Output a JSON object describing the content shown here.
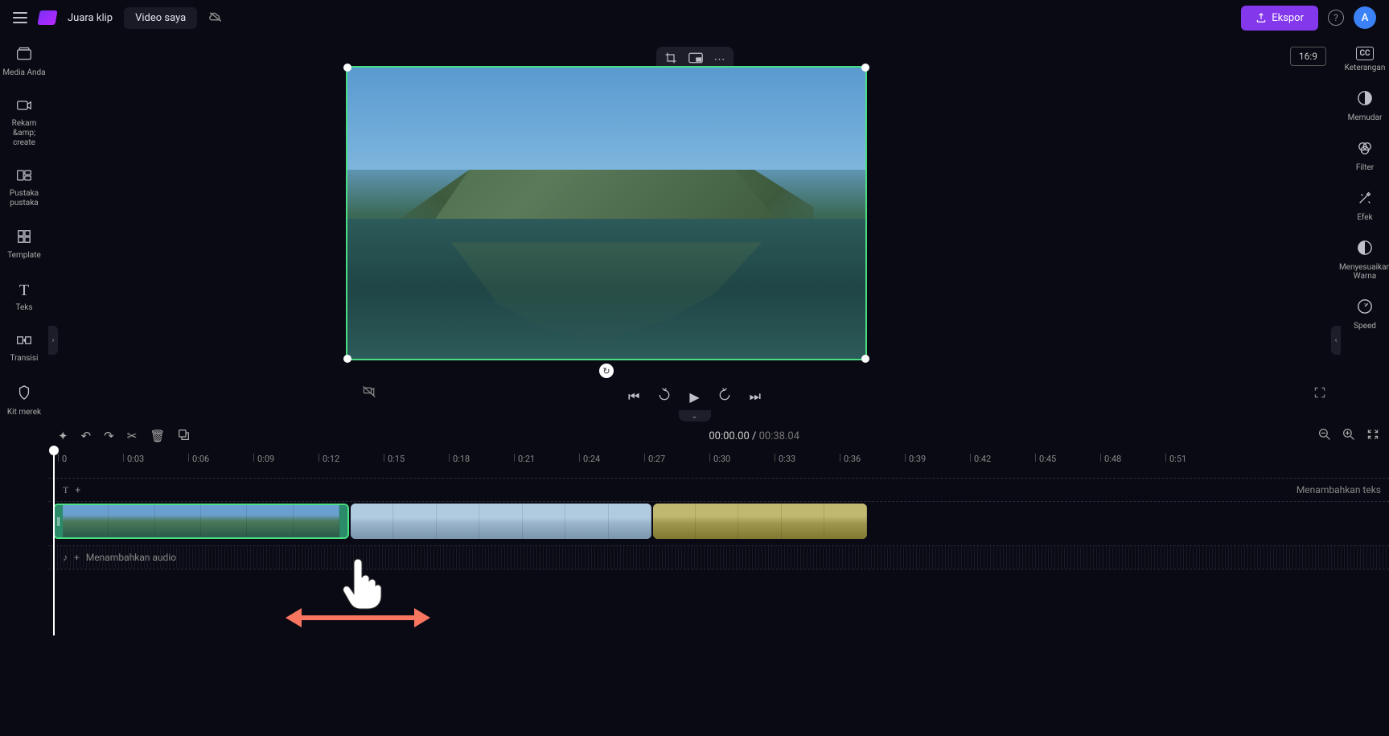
{
  "header": {
    "app_title": "Juara klip",
    "tab_label": "Video saya",
    "export_label": "Ekspor",
    "avatar_initial": "A",
    "aspect_ratio": "16:9"
  },
  "left_sidebar": [
    {
      "icon": "⊞",
      "label": "Media Anda"
    },
    {
      "icon": "◉",
      "label": "Rekam &amp;\ncreate"
    },
    {
      "icon": "▦",
      "label": "Pustaka pustaka"
    },
    {
      "icon": "⊡",
      "label": "Template"
    },
    {
      "icon": "T",
      "label": "Teks"
    },
    {
      "icon": "◈",
      "label": "Transisi"
    },
    {
      "icon": "◇",
      "label": "Kit merek"
    }
  ],
  "right_sidebar": [
    {
      "icon": "CC",
      "label": "Keterangan"
    },
    {
      "icon": "◐",
      "label": "Memudar"
    },
    {
      "icon": "◎",
      "label": "Filter"
    },
    {
      "icon": "✦",
      "label": "Efek"
    },
    {
      "icon": "◑",
      "label": "Menyesuaikan\nWarna"
    },
    {
      "icon": "⊙",
      "label": "Speed"
    }
  ],
  "playback": {
    "current_time": "00:00.00",
    "duration": "00:38.04"
  },
  "ruler_ticks": [
    "0",
    "0:03",
    "0:06",
    "0:09",
    "0:12",
    "0:15",
    "0:18",
    "0:21",
    "0:24",
    "0:27",
    "0:30",
    "0:33",
    "0:36",
    "0:39",
    "0:42",
    "0:45",
    "0:48",
    "0:51"
  ],
  "tracks": {
    "add_text_label": "Menambahkan teks",
    "add_audio_label": "Menambahkan audio"
  }
}
